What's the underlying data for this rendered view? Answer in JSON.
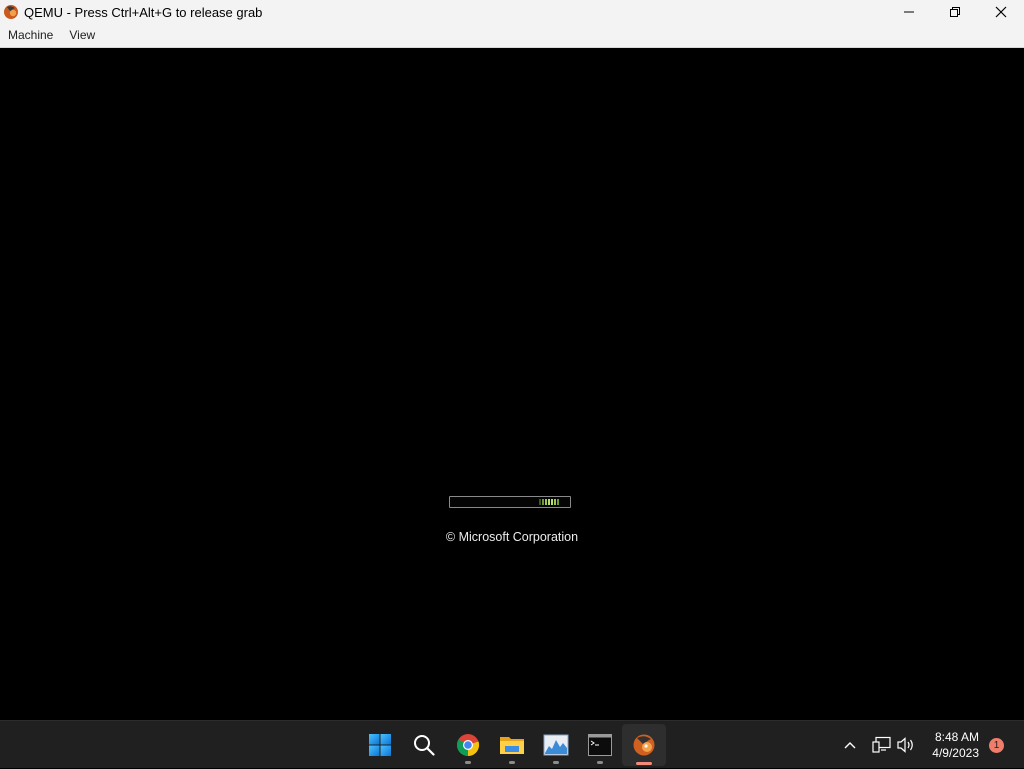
{
  "window": {
    "title": "QEMU - Press Ctrl+Alt+G to release grab",
    "controls": {
      "minimize": "minimize",
      "restore": "restore",
      "close": "close"
    }
  },
  "menubar": {
    "items": [
      {
        "label": "Machine"
      },
      {
        "label": "View"
      }
    ]
  },
  "boot_screen": {
    "copyright": "© Microsoft Corporation",
    "progress_color": "#b5e26b"
  },
  "taskbar": {
    "apps": [
      {
        "name": "start",
        "icon": "windows-start-icon"
      },
      {
        "name": "search",
        "icon": "search-icon"
      },
      {
        "name": "chrome",
        "icon": "chrome-icon"
      },
      {
        "name": "file-explorer",
        "icon": "folder-icon"
      },
      {
        "name": "resource-monitor",
        "icon": "chart-icon"
      },
      {
        "name": "terminal",
        "icon": "terminal-icon"
      },
      {
        "name": "qemu",
        "icon": "qemu-icon"
      }
    ],
    "tray": {
      "time": "8:48 AM",
      "date": "4/9/2023",
      "notification_count": "1"
    }
  },
  "colors": {
    "titlebar_bg": "#f3f3f3",
    "taskbar_bg": "#202020",
    "accent_windows": "#1a8fe8",
    "notification_badge": "#f07d6a"
  }
}
